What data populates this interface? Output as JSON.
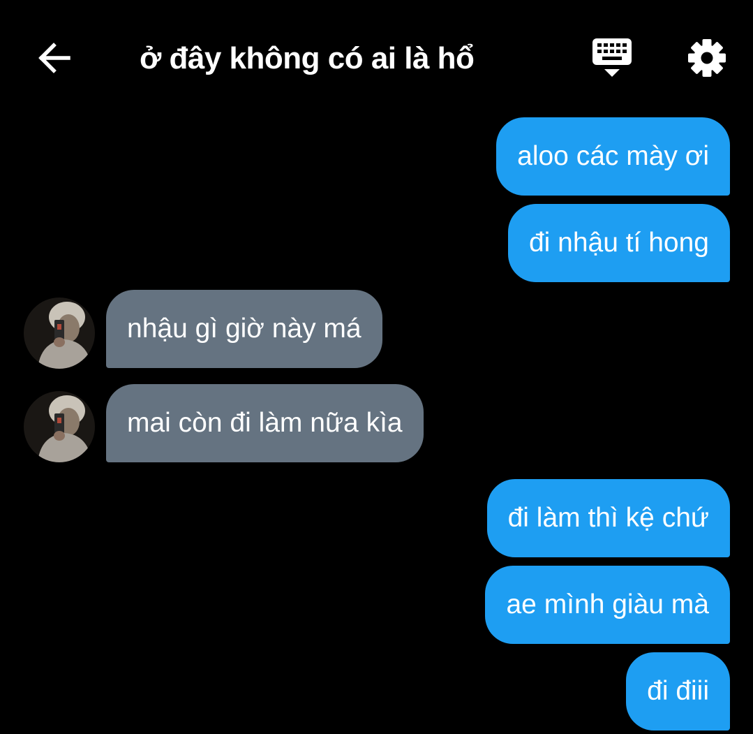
{
  "header": {
    "title": "ở đây không có ai là hổ",
    "back_icon": "arrow-left-icon",
    "keyboard_icon": "keyboard-hide-icon",
    "settings_icon": "gear-icon"
  },
  "colors": {
    "background": "#000000",
    "sent_bubble": "#1e9ef2",
    "received_bubble": "#657381",
    "text": "#ffffff"
  },
  "messages": [
    {
      "side": "sent",
      "text": "aloo các mày ơi"
    },
    {
      "side": "sent",
      "text": "đi nhậu tí hong"
    },
    {
      "side": "received",
      "text": "nhậu gì giờ này má"
    },
    {
      "side": "received",
      "text": "mai còn đi làm nữa kìa"
    },
    {
      "side": "sent",
      "text": "đi làm thì kệ chứ"
    },
    {
      "side": "sent",
      "text": "ae mình giàu mà"
    },
    {
      "side": "sent",
      "text": "đi điii"
    }
  ]
}
